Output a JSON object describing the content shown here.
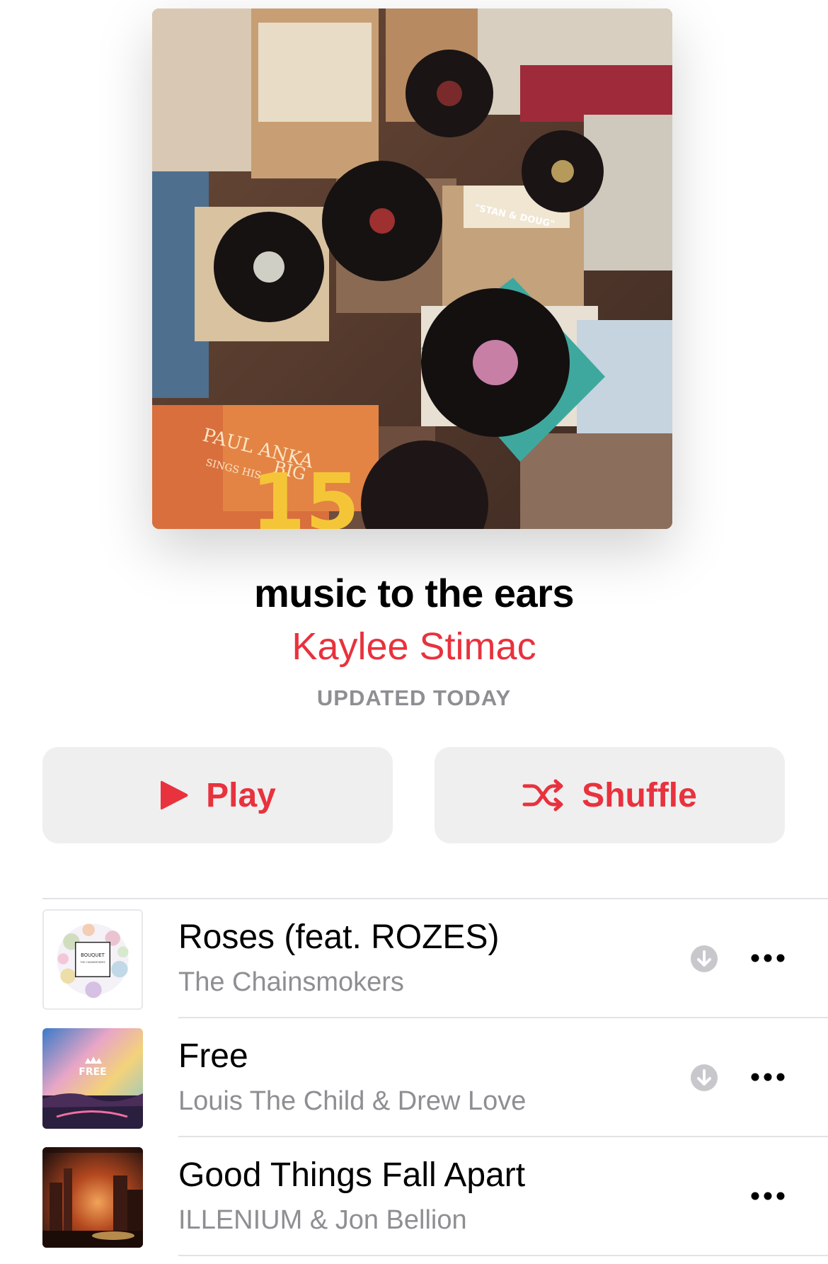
{
  "playlist": {
    "title": "music to the ears",
    "curator": "Kaylee Stimac",
    "updated": "UPDATED TODAY",
    "artwork": {
      "album_text_1": "PAUL ANKA",
      "album_text_2": "SINGS HIS",
      "album_text_3": "BIG",
      "album_text_4": "15",
      "album_text_5": "\"STAN & DOUG\""
    }
  },
  "actions": {
    "play_label": "Play",
    "shuffle_label": "Shuffle"
  },
  "tracks": [
    {
      "title": "Roses (feat. ROZES)",
      "artist": "The Chainsmokers",
      "downloadable": true,
      "artwork_text": "BOUQUET",
      "artwork_subtext": "THE CHAINSMOKERS"
    },
    {
      "title": "Free",
      "artist": "Louis The Child & Drew Love",
      "downloadable": true,
      "artwork_text": "FREE"
    },
    {
      "title": "Good Things Fall Apart",
      "artist": "ILLENIUM & Jon Bellion",
      "downloadable": false
    }
  ],
  "colors": {
    "accent": "#e8323d",
    "secondary_text": "#8e8e93",
    "button_bg": "#efeff0",
    "divider": "#e3e3e6"
  },
  "icons": {
    "play": "play-icon",
    "shuffle": "shuffle-icon",
    "download": "download-icon",
    "more": "more-icon"
  }
}
